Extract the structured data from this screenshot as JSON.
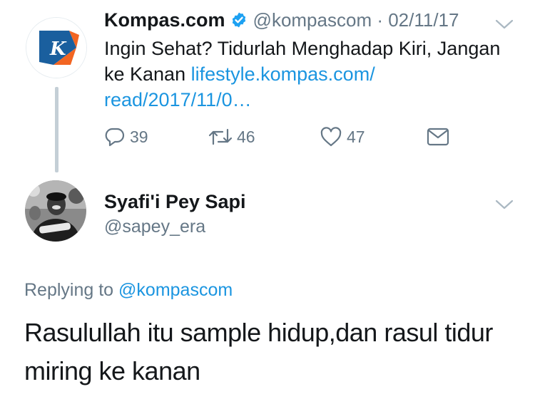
{
  "original_tweet": {
    "display_name": "Kompas.com",
    "handle_time": "@kompascom · 02/11/17",
    "text": "Ingin Sehat? Tidurlah Menghadap Kiri, Jangan ke Kanan",
    "link_text": "lifestyle.kompas.com/ read/2017/11/0…",
    "avatar_letter": "K",
    "actions": {
      "reply_count": "39",
      "retweet_count": "46",
      "like_count": "47"
    }
  },
  "reply_tweet": {
    "display_name": "Syafi'i Pey Sapi",
    "handle": "@sapey_era",
    "replying_prefix": "Replying to",
    "replying_to": "@kompascom",
    "text": "Rasulullah itu sample hidup,dan rasul tidur miring ke kanan"
  },
  "icons": {
    "verified": "verified-badge-icon",
    "chevron": "chevron-down-icon",
    "reply": "reply-icon",
    "retweet": "retweet-icon",
    "like": "heart-icon",
    "message": "envelope-icon"
  },
  "colors": {
    "link": "#1b95e0",
    "secondary_text": "#657786",
    "primary_text": "#14171a",
    "verified": "#1da1f2",
    "kompas_blue": "#1a5f9e",
    "kompas_orange": "#f26522",
    "thread_line": "#c4cfd6"
  }
}
